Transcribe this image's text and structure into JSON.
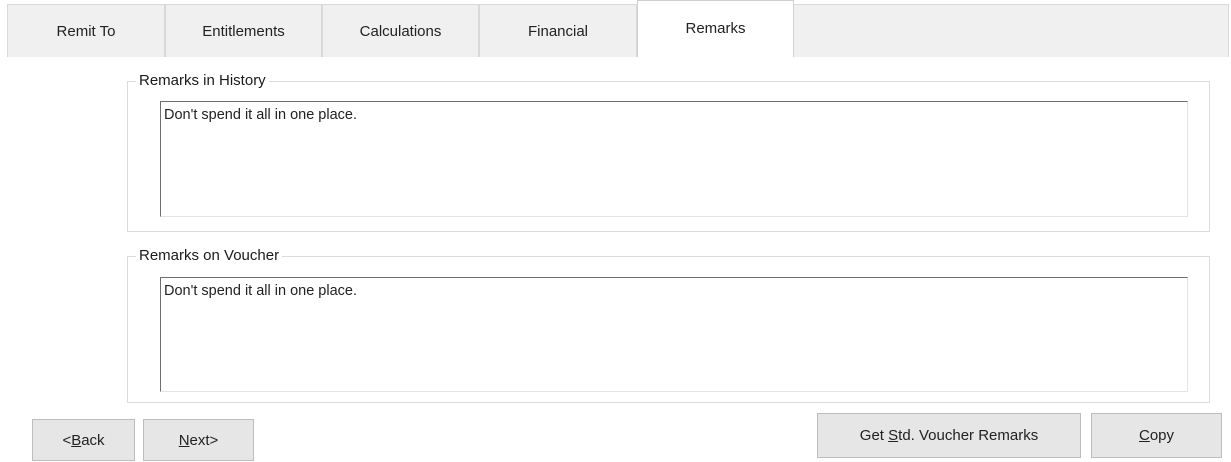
{
  "tabs": [
    {
      "label": "Remit To",
      "active": false
    },
    {
      "label": "Entitlements",
      "active": false
    },
    {
      "label": "Calculations",
      "active": false
    },
    {
      "label": "Financial",
      "active": false
    },
    {
      "label": "Remarks",
      "active": true
    }
  ],
  "remarks_history": {
    "title": "Remarks in History",
    "value": "Don't spend it all in one place."
  },
  "remarks_voucher": {
    "title": "Remarks on Voucher",
    "value": "Don't spend it all in one place."
  },
  "buttons": {
    "back": {
      "prefix": "<",
      "mnemonic": "B",
      "rest": "ack"
    },
    "next": {
      "mnemonic": "N",
      "rest": "ext>"
    },
    "get_std": {
      "prefix": "Get ",
      "mnemonic": "S",
      "rest": "td. Voucher Remarks"
    },
    "copy": {
      "mnemonic": "C",
      "rest": "opy"
    }
  }
}
